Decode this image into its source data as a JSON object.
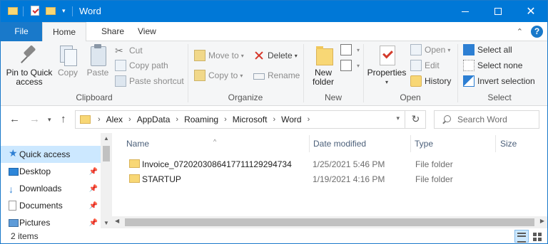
{
  "window": {
    "title": "Word",
    "minimize_glyph": "",
    "maximize_glyph": "",
    "close_glyph": "✕"
  },
  "tabs": {
    "file": "File",
    "home": "Home",
    "share": "Share",
    "view": "View",
    "collapse_glyph": "⌃",
    "help": "?"
  },
  "ribbon": {
    "clipboard": {
      "label": "Clipboard",
      "pin": "Pin to Quick access",
      "copy": "Copy",
      "paste": "Paste",
      "cut": "Cut",
      "copy_path": "Copy path",
      "paste_shortcut": "Paste shortcut"
    },
    "organize": {
      "label": "Organize",
      "move_to": "Move to",
      "copy_to": "Copy to",
      "delete": "Delete",
      "rename": "Rename"
    },
    "new": {
      "label": "New",
      "new_folder": "New folder"
    },
    "open": {
      "label": "Open",
      "properties": "Properties",
      "open": "Open",
      "edit": "Edit",
      "history": "History"
    },
    "select": {
      "label": "Select",
      "select_all": "Select all",
      "select_none": "Select none",
      "invert": "Invert selection"
    }
  },
  "address": {
    "crumbs": [
      "Alex",
      "AppData",
      "Roaming",
      "Microsoft",
      "Word"
    ],
    "search_placeholder": "Search Word"
  },
  "nav": {
    "items": [
      {
        "label": "Quick access",
        "icon": "star-icon",
        "selected": true
      },
      {
        "label": "Desktop",
        "icon": "desktop-icon"
      },
      {
        "label": "Downloads",
        "icon": "download-icon"
      },
      {
        "label": "Documents",
        "icon": "documents-icon"
      },
      {
        "label": "Pictures",
        "icon": "pictures-icon"
      }
    ]
  },
  "list": {
    "columns": {
      "name": "Name",
      "date": "Date modified",
      "type": "Type",
      "size": "Size"
    },
    "rows": [
      {
        "name": "Invoice_07202030864177111292947​34",
        "date": "1/25/2021 5:46 PM",
        "type": "File folder"
      },
      {
        "name": "STARTUP",
        "date": "1/19/2021 4:16 PM",
        "type": "File folder"
      }
    ]
  },
  "status": {
    "count": "2 items"
  }
}
